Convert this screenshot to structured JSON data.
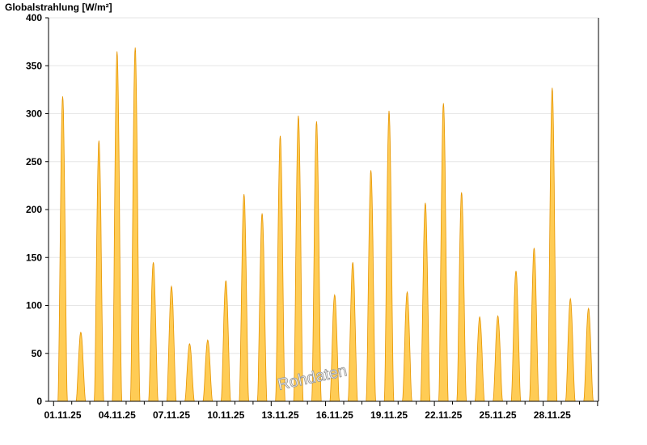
{
  "chart_data": {
    "type": "area",
    "title": "",
    "ylabel": "Globalstrahlung [W/m²]",
    "xlabel": "",
    "ylim": [
      0,
      400
    ],
    "yticks": [
      0,
      50,
      100,
      150,
      200,
      250,
      300,
      350,
      400
    ],
    "xticks": [
      "01.11.25",
      "04.11.25",
      "07.11.25",
      "10.11.25",
      "13.11.25",
      "16.11.25",
      "19.11.25",
      "22.11.25",
      "25.11.25",
      "28.11.25"
    ],
    "xrange_days": [
      0.72,
      31.05
    ],
    "grid": true,
    "colors": {
      "fill": "#ffcc55",
      "stroke": "#e69500",
      "grid": "#e6e6e6",
      "axis": "#000000"
    },
    "watermark": "Rohdaten",
    "days": [
      "01.11.25",
      "02.11.25",
      "03.11.25",
      "04.11.25",
      "05.11.25",
      "06.11.25",
      "07.11.25",
      "08.11.25",
      "09.11.25",
      "10.11.25",
      "11.11.25",
      "12.11.25",
      "13.11.25",
      "14.11.25",
      "15.11.25",
      "16.11.25",
      "17.11.25",
      "18.11.25",
      "19.11.25",
      "20.11.25",
      "21.11.25",
      "22.11.25",
      "23.11.25",
      "24.11.25",
      "25.11.25",
      "26.11.25",
      "27.11.25",
      "28.11.25",
      "29.11.25",
      "30.11.25"
    ],
    "daily_peaks": [
      318,
      72,
      272,
      365,
      369,
      145,
      120,
      60,
      64,
      126,
      216,
      196,
      277,
      298,
      292,
      111,
      145,
      241,
      303,
      114,
      207,
      311,
      218,
      88,
      89,
      136,
      160,
      327,
      107,
      97
    ]
  }
}
